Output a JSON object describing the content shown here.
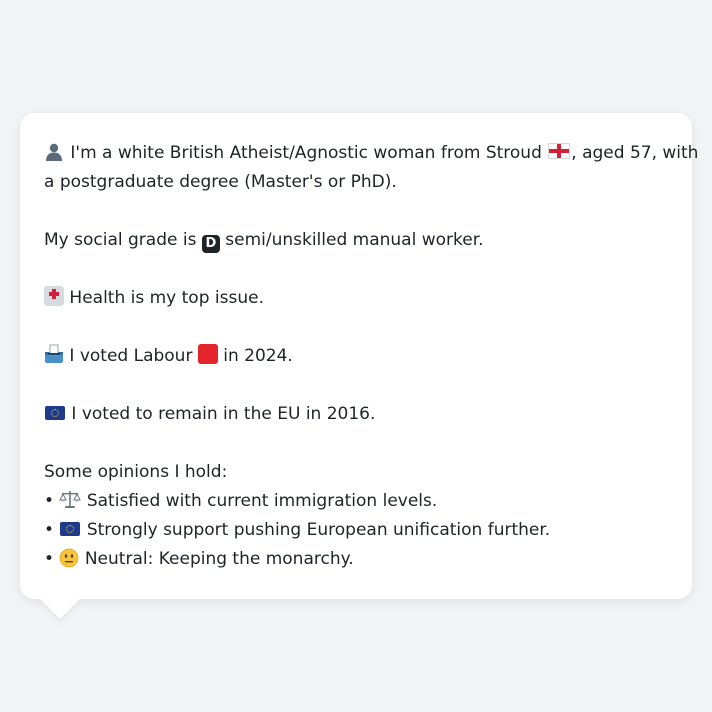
{
  "card": {
    "identity": {
      "text_before_flag": "I'm a white British Atheist/Agnostic woman from Stroud",
      "text_after_flag": ", aged 57, with",
      "line2": "a postgraduate degree (Master's or PhD)."
    },
    "social_grade": {
      "before": "My social grade is",
      "badge": "D",
      "after": "semi/unskilled manual worker."
    },
    "top_issue": "Health is my top issue.",
    "vote_2024": {
      "before": "I voted Labour",
      "after": "in 2024."
    },
    "eu_vote": "I voted to remain in the EU in 2016.",
    "opinions_heading": "Some opinions I hold:",
    "opinions": [
      {
        "bullet": "•",
        "text": "Satisfied with current immigration levels.",
        "icon": "scales-icon"
      },
      {
        "bullet": "•",
        "text": "Strongly support pushing European unification further.",
        "icon": "eu-flag-icon"
      },
      {
        "bullet": "•",
        "text": "Neutral: Keeping the monarchy.",
        "icon": "neutral-face-icon"
      }
    ]
  },
  "icons": {
    "identity": "person-silhouette-icon",
    "flag": "england-flag-icon",
    "grade": "letter-d-icon",
    "issue": "hospital-icon",
    "vote": "ballot-box-icon",
    "party": "red-square-icon",
    "eu": "eu-flag-icon"
  },
  "colors": {
    "background": "#f2f3f5",
    "card": "#ffffff",
    "text": "#1f2328",
    "labour_red": "#e3242b",
    "eu_blue": "#1e3a8a"
  }
}
